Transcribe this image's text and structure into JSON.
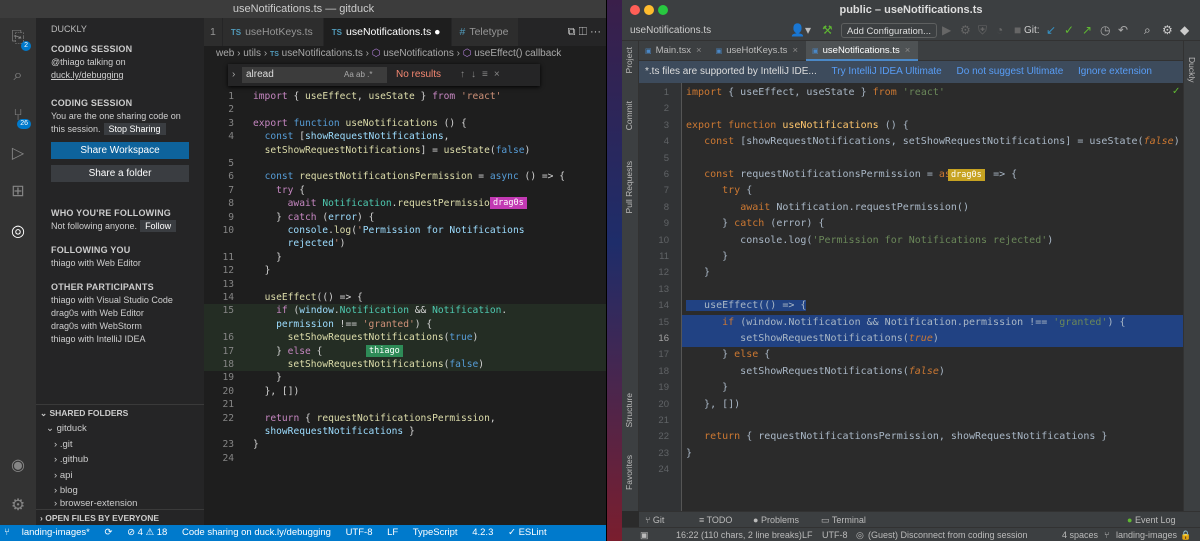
{
  "vscode": {
    "title": "useNotifications.ts — gitduck",
    "activity_badges": {
      "account": "2",
      "scm": "26"
    },
    "sidebar": {
      "header": "DUCKLY",
      "coding_session": {
        "title": "CODING SESSION",
        "user_line": "@thiago talking on",
        "link": "duck.ly/debugging"
      },
      "coding_session2": {
        "title": "CODING SESSION",
        "line1": "You are the one sharing code on",
        "line2": "this session.",
        "stop_button": "Stop Sharing",
        "share_workspace": "Share Workspace",
        "share_folder": "Share a folder"
      },
      "following": {
        "title": "WHO YOU'RE FOLLOWING",
        "text": "Not following anyone.",
        "follow_button": "Follow"
      },
      "following_you": {
        "title": "FOLLOWING YOU",
        "text": "thiago with Web Editor"
      },
      "participants": {
        "title": "OTHER PARTICIPANTS",
        "items": [
          "thiago with Visual Studio Code",
          "drag0s with Web Editor",
          "drag0s with WebStorm",
          "thiago with IntelliJ IDEA"
        ]
      },
      "shared_folders": {
        "title": "SHARED FOLDERS",
        "root": "gitduck",
        "items": [
          ".git",
          ".github",
          "api",
          "blog",
          "browser-extension"
        ]
      },
      "open_files": "OPEN FILES BY EVERYONE"
    },
    "tabs": [
      {
        "label": "1",
        "icon": ""
      },
      {
        "label": "useHotKeys.ts",
        "icon": "TS"
      },
      {
        "label": "useNotifications.ts",
        "icon": "TS",
        "dirty": "●"
      },
      {
        "label": "Teletype",
        "icon": "#"
      }
    ],
    "breadcrumb": [
      "web",
      "utils",
      "useNotifications.ts",
      "useNotifications",
      "useEffect() callback"
    ],
    "find": {
      "query": "alread",
      "options": "Aa  ab  .*",
      "result": "No results"
    },
    "cursors": {
      "drag0s": "drag0s",
      "thiago": "thiago"
    },
    "statusbar": {
      "branch": "landing-images*",
      "sync": "⟳",
      "problems": "⊘ 4 ⚠ 18",
      "sharing": "Code sharing on duck.ly/debugging",
      "encoding": "UTF-8",
      "eol": "LF",
      "language": "TypeScript",
      "version": "4.2.3",
      "eslint": "✓ ESLint"
    }
  },
  "intellij": {
    "title": "public – useNotifications.ts",
    "project_file": "useNotifications.ts",
    "add_config": "Add Configuration...",
    "git_label": "Git:",
    "side_left": [
      "Project",
      "Commit",
      "Pull Requests",
      "Structure",
      "Favorites"
    ],
    "side_right": "Duckly",
    "tabs": [
      {
        "label": "Main.tsx"
      },
      {
        "label": "useHotKeys.ts"
      },
      {
        "label": "useNotifications.ts"
      }
    ],
    "banner": {
      "text": "*.ts files are supported by IntelliJ IDE...",
      "link1": "Try IntelliJ IDEA Ultimate",
      "link2": "Do not suggest Ultimate",
      "link3": "Ignore extension"
    },
    "cursor_flag": "drag0s",
    "bottom_tabs": [
      "Git",
      "TODO",
      "Problems",
      "Terminal",
      "Event Log"
    ],
    "status": {
      "position": "16:22 (110 chars, 2 line breaks)",
      "eol": "LF",
      "encoding": "UTF-8",
      "message": "(Guest) Disconnect from coding session",
      "indent": "4 spaces",
      "branch": "landing-images"
    }
  },
  "code_lines": [
    "import { useEffect, useState } from 'react'",
    "",
    "export function useNotifications () {",
    "  const [showRequestNotifications, setShowRequestNotifications] = useState(false)",
    "",
    "  const requestNotificationsPermission = async () => {",
    "    try {",
    "      await Notification.requestPermission()",
    "    } catch (error) {",
    "      console.log('Permission for Notifications rejected')",
    "    }",
    "  }",
    "",
    "  useEffect(() => {",
    "    if (window.Notification && Notification.permission !== 'granted') {",
    "      setShowRequestNotifications(true)",
    "    } else {",
    "      setShowRequestNotifications(false)",
    "    }",
    "  }, [])",
    "",
    "  return { requestNotificationsPermission, showRequestNotifications }",
    "}",
    ""
  ],
  "colors": {
    "vscode_status": "#007acc",
    "share_button": "#0e639c",
    "drag0s_cursor": "#c239b3",
    "thiago_cursor": "#2e8b57",
    "ij_selection": "#214283",
    "ij_flag": "#c7a322"
  }
}
